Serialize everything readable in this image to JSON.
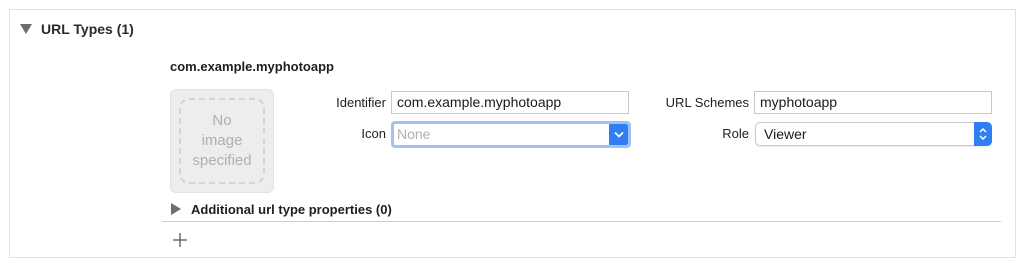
{
  "section": {
    "title": "URL Types (1)"
  },
  "entry": {
    "title": "com.example.myphotoapp",
    "image_well": {
      "placeholder": "No\nimage\nspecified"
    },
    "identifier": {
      "label": "Identifier",
      "value": "com.example.myphotoapp"
    },
    "icon": {
      "label": "Icon",
      "placeholder": "None"
    },
    "url_schemes": {
      "label": "URL Schemes",
      "value": "myphotoapp"
    },
    "role": {
      "label": "Role",
      "value": "Viewer"
    },
    "additional": {
      "title": "Additional url type properties (0)"
    }
  },
  "colors": {
    "accent": "#2f7ff2",
    "focus_ring": "#9fc3ee"
  }
}
